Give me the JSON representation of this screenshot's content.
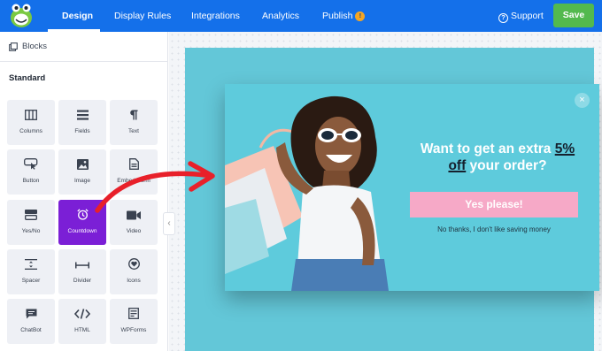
{
  "header": {
    "tabs": [
      {
        "label": "Design",
        "active": true
      },
      {
        "label": "Display Rules"
      },
      {
        "label": "Integrations"
      },
      {
        "label": "Analytics"
      },
      {
        "label": "Publish",
        "badge": "!"
      }
    ],
    "support_label": "Support",
    "save_label": "Save"
  },
  "sidebar": {
    "blocks_label": "Blocks",
    "section_title": "Standard",
    "tiles": [
      {
        "label": "Columns",
        "icon": "columns-icon"
      },
      {
        "label": "Fields",
        "icon": "fields-icon"
      },
      {
        "label": "Text",
        "icon": "paragraph-icon"
      },
      {
        "label": "Button",
        "icon": "button-cursor-icon"
      },
      {
        "label": "Image",
        "icon": "image-icon"
      },
      {
        "label": "Embed Form",
        "icon": "embed-form-icon"
      },
      {
        "label": "Yes/No",
        "icon": "yes-no-icon"
      },
      {
        "label": "Countdown",
        "icon": "alarm-clock-icon",
        "active": true
      },
      {
        "label": "Video",
        "icon": "video-camera-icon"
      },
      {
        "label": "Spacer",
        "icon": "spacer-icon"
      },
      {
        "label": "Divider",
        "icon": "divider-icon"
      },
      {
        "label": "Icons",
        "icon": "heart-badge-icon"
      },
      {
        "label": "ChatBot",
        "icon": "chat-bubble-icon"
      },
      {
        "label": "HTML",
        "icon": "code-brackets-icon"
      },
      {
        "label": "WPForms",
        "icon": "wpforms-icon"
      }
    ]
  },
  "popup": {
    "headline_pre": "Want to get an extra ",
    "headline_highlight_1": "5%",
    "headline_highlight_2": "off",
    "headline_post": " your order?",
    "yes_label": "Yes please!",
    "no_label": "No thanks, I don't like saving money",
    "close_symbol": "×"
  },
  "colors": {
    "topbar": "#1470ea",
    "save": "#53b94e",
    "active_tile": "#7b1fd6",
    "popup_bg": "#5ecbdc",
    "yes_button": "#f6a9c7",
    "arrow": "#e8202a"
  }
}
